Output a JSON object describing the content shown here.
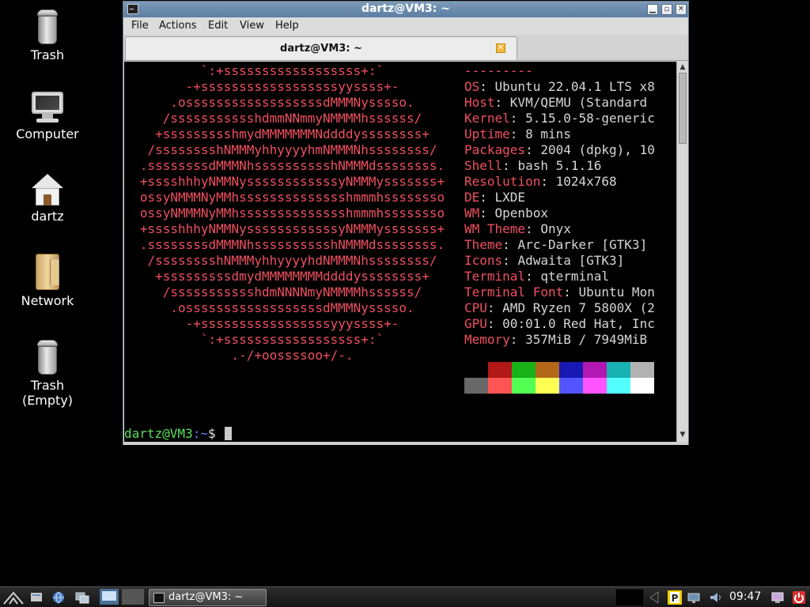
{
  "desktop": {
    "icons": [
      {
        "label": "Trash"
      },
      {
        "label": "Computer"
      },
      {
        "label": "dartz"
      },
      {
        "label": "Network"
      },
      {
        "label": "Trash\n(Empty)"
      }
    ]
  },
  "window": {
    "title": "dartz@VM3: ~",
    "menu": [
      "File",
      "Actions",
      "Edit",
      "View",
      "Help"
    ],
    "tab_label": "dartz@VM3: ~"
  },
  "terminal": {
    "ascii_art": [
      "`:+ssssssssssssssssss+:`",
      "-+ssssssssssssssssssyyssss+-",
      ".ossssssssssssssssssdMMMNysssso.",
      "/ssssssssssshdmmNNmmyNMMMMhssssss/",
      "+ssssssssshmydMMMMMMMNddddyssssssss+",
      "/sssssssshNMMMyhhyyyyhmNMMMNhssssssss/",
      ".ssssssssdMMMNhsssssssssshNMMMdssssssss.",
      "+sssshhhyNMMNyssssssssssssyNMMMysssssss+",
      "ossyNMMMNyMMhsssssssssssssshmmmhssssssso",
      "ossyNMMMNyMMhsssssssssssssshmmmhssssssso",
      "+sssshhhyNMMNyssssssssssssyNMMMysssssss+",
      ".ssssssssdMMMNhsssssssssshNMMMdssssssss.",
      "/sssssssshNMMMyhhyyyyhdNMMMNhssssssss/",
      "+sssssssssdmydMMMMMMMMddddyssssssss+",
      "/ssssssssssshdmNNNNmyNMMMMhssssss/",
      ".ossssssssssssssssssdMMMNysssso.",
      "-+sssssssssssssssssyyyssss+-",
      "`:+ssssssssssssssssss+:`",
      ".-/+oossssoo+/-."
    ],
    "separator": "---------",
    "info": [
      {
        "key": "OS",
        "value": "Ubuntu 22.04.1 LTS x8"
      },
      {
        "key": "Host",
        "value": "KVM/QEMU (Standard"
      },
      {
        "key": "Kernel",
        "value": "5.15.0-58-generic"
      },
      {
        "key": "Uptime",
        "value": "8 mins"
      },
      {
        "key": "Packages",
        "value": "2004 (dpkg), 10"
      },
      {
        "key": "Shell",
        "value": "bash 5.1.16"
      },
      {
        "key": "Resolution",
        "value": "1024x768"
      },
      {
        "key": "DE",
        "value": "LXDE"
      },
      {
        "key": "WM",
        "value": "Openbox"
      },
      {
        "key": "WM Theme",
        "value": "Onyx"
      },
      {
        "key": "Theme",
        "value": "Arc-Darker [GTK3]"
      },
      {
        "key": "Icons",
        "value": "Adwaita [GTK3]"
      },
      {
        "key": "Terminal",
        "value": "qterminal"
      },
      {
        "key": "Terminal Font",
        "value": "Ubuntu Mon"
      },
      {
        "key": "CPU",
        "value": "AMD Ryzen 7 5800X (2"
      },
      {
        "key": "GPU",
        "value": "00:01.0 Red Hat, Inc"
      },
      {
        "key": "Memory",
        "value": "357MiB / 7949MiB"
      }
    ],
    "palette_row1": [
      "#000000",
      "#b21818",
      "#18b218",
      "#b26818",
      "#1818b2",
      "#b218b2",
      "#18b2b2",
      "#b2b2b2"
    ],
    "palette_row2": [
      "#686868",
      "#ff5454",
      "#54ff54",
      "#ffff54",
      "#5454ff",
      "#ff54ff",
      "#54ffff",
      "#ffffff"
    ],
    "prompt": {
      "user_host": "dartz@VM3",
      "path": ":~",
      "sign": "$ "
    }
  },
  "taskbar": {
    "task_label": "dartz@VM3: ~",
    "clock": "09:47"
  },
  "colors": {
    "accent_red": "#ee5060",
    "prompt_green": "#57e057",
    "prompt_blue": "#6d7dff"
  }
}
